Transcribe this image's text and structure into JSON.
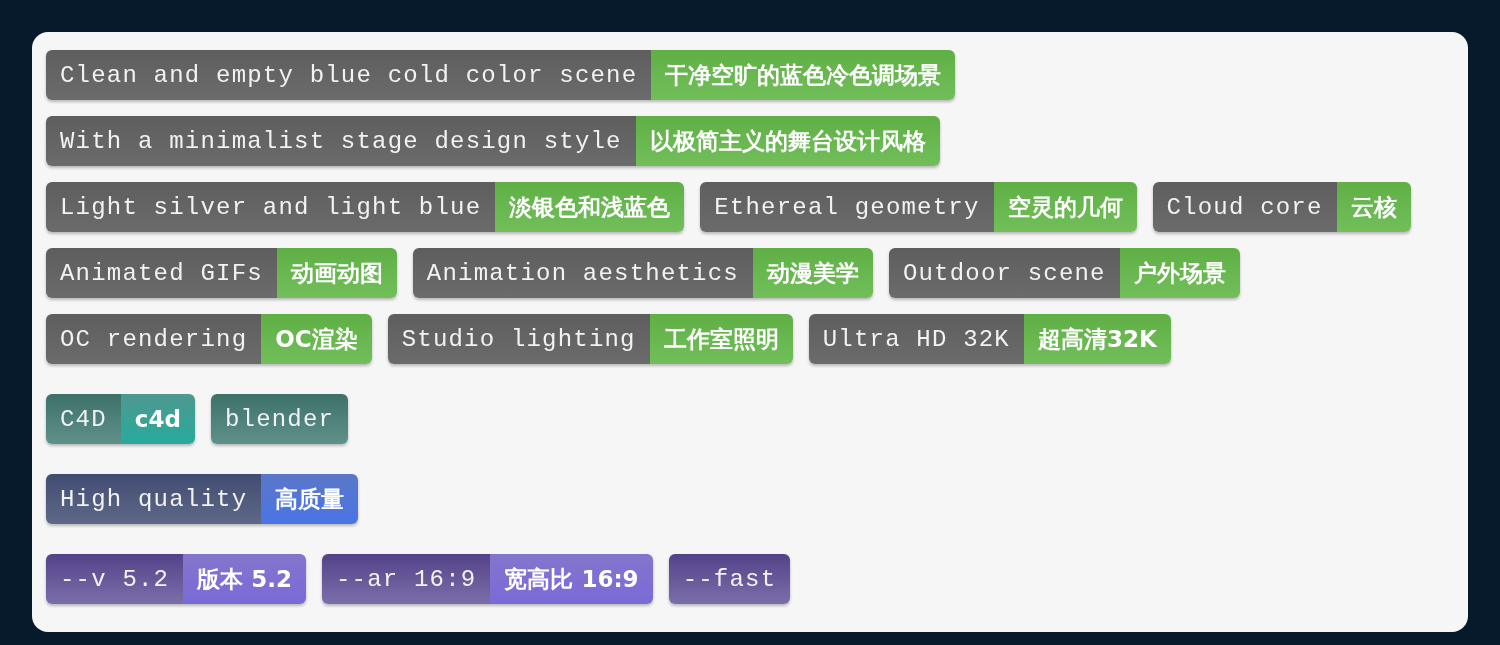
{
  "groups": [
    {
      "kind": "style",
      "tags": [
        {
          "text": "Clean and empty blue cold color scene",
          "translation": "干净空旷的蓝色冷色调场景"
        },
        {
          "text": "With a minimalist stage design style",
          "translation": "以极简主义的舞台设计风格"
        },
        {
          "text": "Light silver and light blue",
          "translation": "淡银色和浅蓝色"
        },
        {
          "text": "Ethereal geometry",
          "translation": "空灵的几何"
        },
        {
          "text": "Cloud core",
          "translation": "云核"
        },
        {
          "text": "Animated GIFs",
          "translation": "动画动图"
        },
        {
          "text": "Animation aesthetics",
          "translation": "动漫美学"
        },
        {
          "text": "Outdoor scene",
          "translation": "户外场景"
        },
        {
          "text": "OC rendering",
          "translation": "OC渲染"
        },
        {
          "text": "Studio lighting",
          "translation": "工作室照明"
        },
        {
          "text": "Ultra HD 32K",
          "translation": "超高清32K"
        }
      ]
    },
    {
      "kind": "software",
      "tags": [
        {
          "text": "C4D",
          "translation": "c4d"
        },
        {
          "text": "blender"
        }
      ]
    },
    {
      "kind": "quality",
      "tags": [
        {
          "text": "High quality",
          "translation": "高质量"
        }
      ]
    },
    {
      "kind": "param",
      "tags": [
        {
          "text": "--v 5.2",
          "translation": "版本 5.2"
        },
        {
          "text": "--ar 16:9",
          "translation": "宽高比 16:9"
        },
        {
          "text": "--fast"
        }
      ]
    }
  ]
}
